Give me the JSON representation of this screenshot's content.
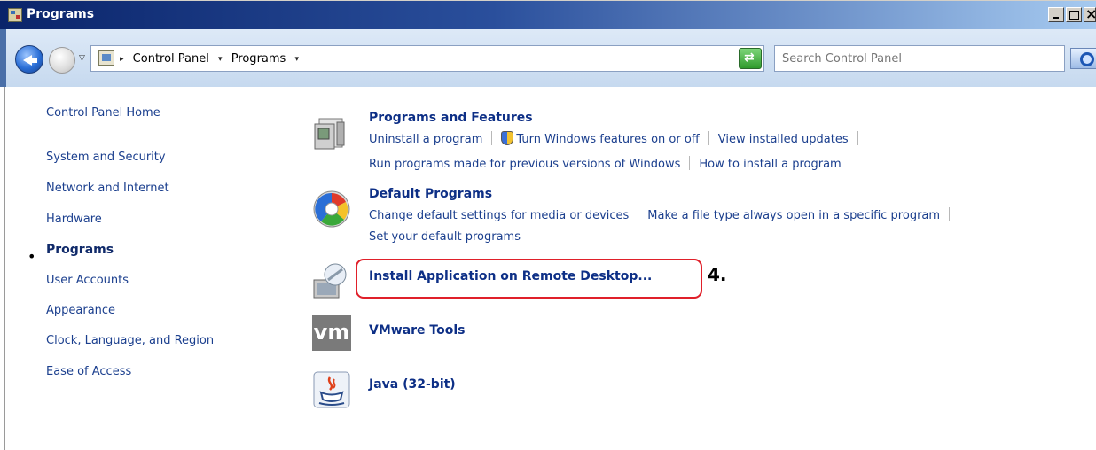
{
  "window": {
    "title": "Programs"
  },
  "address": {
    "crumbs": [
      "Control Panel",
      "Programs"
    ]
  },
  "search": {
    "placeholder": "Search Control Panel"
  },
  "sidebar": {
    "items": [
      {
        "label": "Control Panel Home"
      },
      {
        "label": "System and Security"
      },
      {
        "label": "Network and Internet"
      },
      {
        "label": "Hardware"
      },
      {
        "label": "Programs",
        "current": true
      },
      {
        "label": "User Accounts"
      },
      {
        "label": "Appearance"
      },
      {
        "label": "Clock, Language, and Region"
      },
      {
        "label": "Ease of Access"
      }
    ]
  },
  "categories": {
    "programs_features": {
      "title": "Programs and Features",
      "line1": [
        "Uninstall a program",
        "Turn Windows features on or off",
        "View installed updates"
      ],
      "line2": [
        "Run programs made for previous versions of Windows",
        "How to install a program"
      ],
      "icon": "programs-features-icon"
    },
    "default_programs": {
      "title": "Default Programs",
      "line1": [
        "Change default settings for media or devices",
        "Make a file type always open in a specific program"
      ],
      "line2": [
        "Set your default programs"
      ],
      "icon": "default-programs-icon"
    },
    "remote_desktop": {
      "title": "Install Application on Remote Desktop...",
      "icon": "remote-desktop-icon"
    },
    "vmware": {
      "title": "VMware Tools",
      "icon_text": "vm",
      "icon": "vmware-icon"
    },
    "java": {
      "title": "Java (32-bit)",
      "icon": "java-icon"
    }
  },
  "annotation": {
    "step": "4.",
    "color": "#e0202a"
  }
}
